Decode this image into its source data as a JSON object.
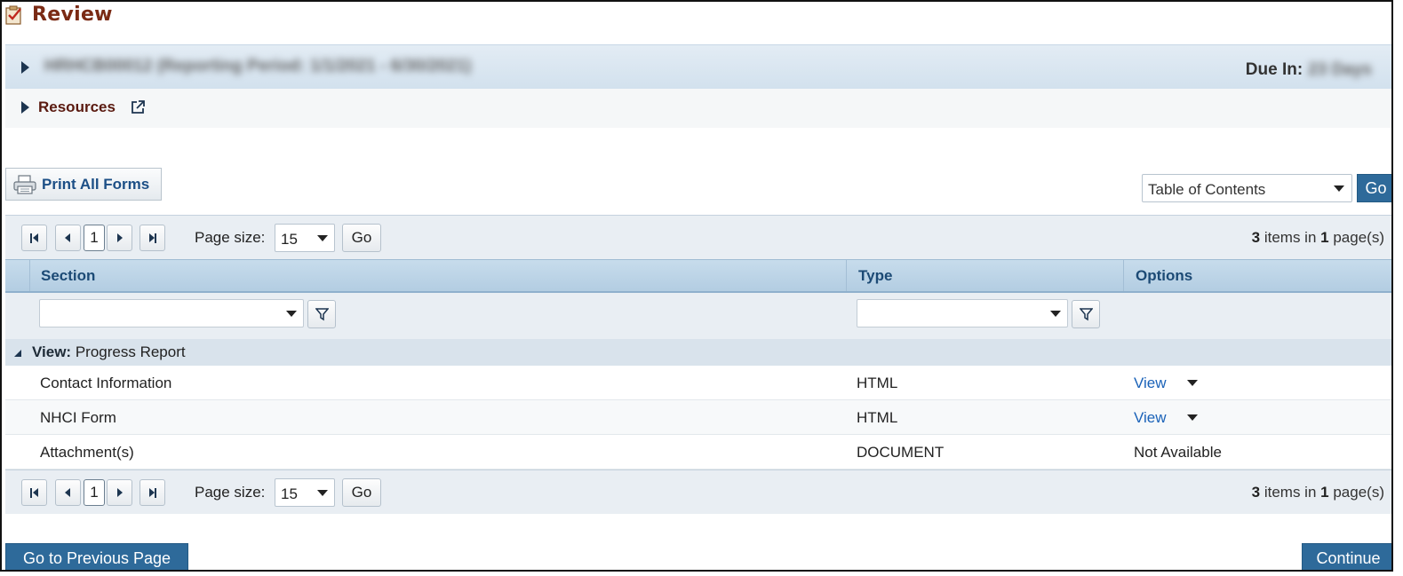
{
  "page": {
    "title": "Review"
  },
  "award": {
    "title": "HRHCB00012 (Reporting Period: 1/1/2021 - 6/30/2021)",
    "due_label": "Due In:",
    "due_value": "23 Days"
  },
  "resources": {
    "label": "Resources"
  },
  "toolbar": {
    "print_label": "Print All Forms",
    "toc_value": "Table of Contents",
    "toc_go": "Go"
  },
  "pager": {
    "current_page": "1",
    "page_size_label": "Page size:",
    "page_size": "15",
    "go": "Go",
    "items_count": "3",
    "items_text_mid": " items in ",
    "pages_count": "1",
    "items_text_end": " page(s)"
  },
  "grid": {
    "columns": {
      "section": "Section",
      "type": "Type",
      "options": "Options"
    },
    "group": {
      "label": "View:",
      "value": " Progress Report"
    },
    "rows": [
      {
        "section": "Contact Information",
        "type": "HTML",
        "option": "View"
      },
      {
        "section": "NHCI Form",
        "type": "HTML",
        "option": "View"
      },
      {
        "section": "Attachment(s)",
        "type": "DOCUMENT",
        "option": "Not Available"
      }
    ]
  },
  "footer": {
    "previous": "Go to Previous Page",
    "continue": "Continue"
  },
  "colors": {
    "title": "#7a2a14",
    "header_blue": "#1c4a75",
    "button_blue": "#2e6a9a",
    "link": "#1a62b8"
  }
}
